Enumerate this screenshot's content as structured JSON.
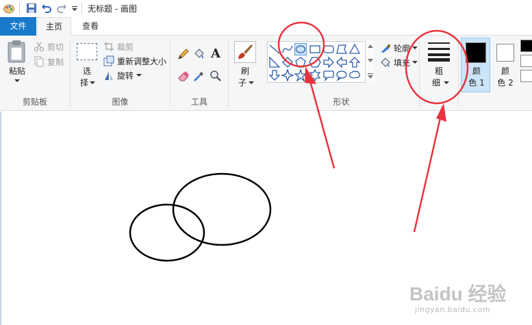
{
  "window": {
    "title": "无标题 - 画图"
  },
  "tabs": {
    "file": "文件",
    "home": "主页",
    "view": "查看"
  },
  "clipboard": {
    "paste": "粘贴",
    "cut": "剪切",
    "copy": "复制",
    "group": "剪贴板"
  },
  "image": {
    "select_1": "选",
    "select_2": "择",
    "crop": "裁剪",
    "resize": "重新调整大小",
    "rotate": "旋转",
    "group": "图像"
  },
  "tools": {
    "group": "工具",
    "text_glyph": "A"
  },
  "brush": {
    "label_1": "刷",
    "label_2": "子"
  },
  "shapes": {
    "outline": "轮廓",
    "fill": "填充",
    "group": "形状",
    "selected": "oval-shape"
  },
  "size": {
    "label_1": "粗",
    "label_2": "细"
  },
  "colors": {
    "color1_label_1": "颜",
    "color1_label_2": "色 1",
    "color2_label_1": "颜",
    "color2_label_2": "色 2",
    "color1": "#000000",
    "color2": "#ffffff",
    "annotation": "#e8323c"
  },
  "watermark": {
    "logo": "Baidu 经验",
    "url": "jingyan.baidu.com"
  }
}
